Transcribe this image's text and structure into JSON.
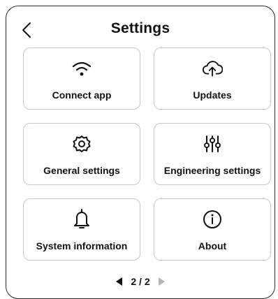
{
  "header": {
    "title": "Settings",
    "back_icon": "chevron-left-icon"
  },
  "tiles": [
    {
      "label": "Connect app",
      "icon": "wifi-icon"
    },
    {
      "label": "Updates",
      "icon": "cloud-upload-icon"
    },
    {
      "label": "General settings",
      "icon": "gear-icon"
    },
    {
      "label": "Engineering settings",
      "icon": "sliders-icon"
    },
    {
      "label": "System information",
      "icon": "bell-icon"
    },
    {
      "label": "About",
      "icon": "info-icon"
    }
  ],
  "pagination": {
    "current": "2",
    "separator": "/",
    "total": "2",
    "prev_icon": "triangle-left-icon",
    "next_icon": "triangle-right-icon",
    "colors": {
      "active": "#111111",
      "inactive": "#b5b5b5"
    }
  },
  "colors": {
    "text": "#111111",
    "tile_border": "#c8c8c8",
    "screen_border": "#2a2a2a",
    "background": "#ffffff"
  }
}
